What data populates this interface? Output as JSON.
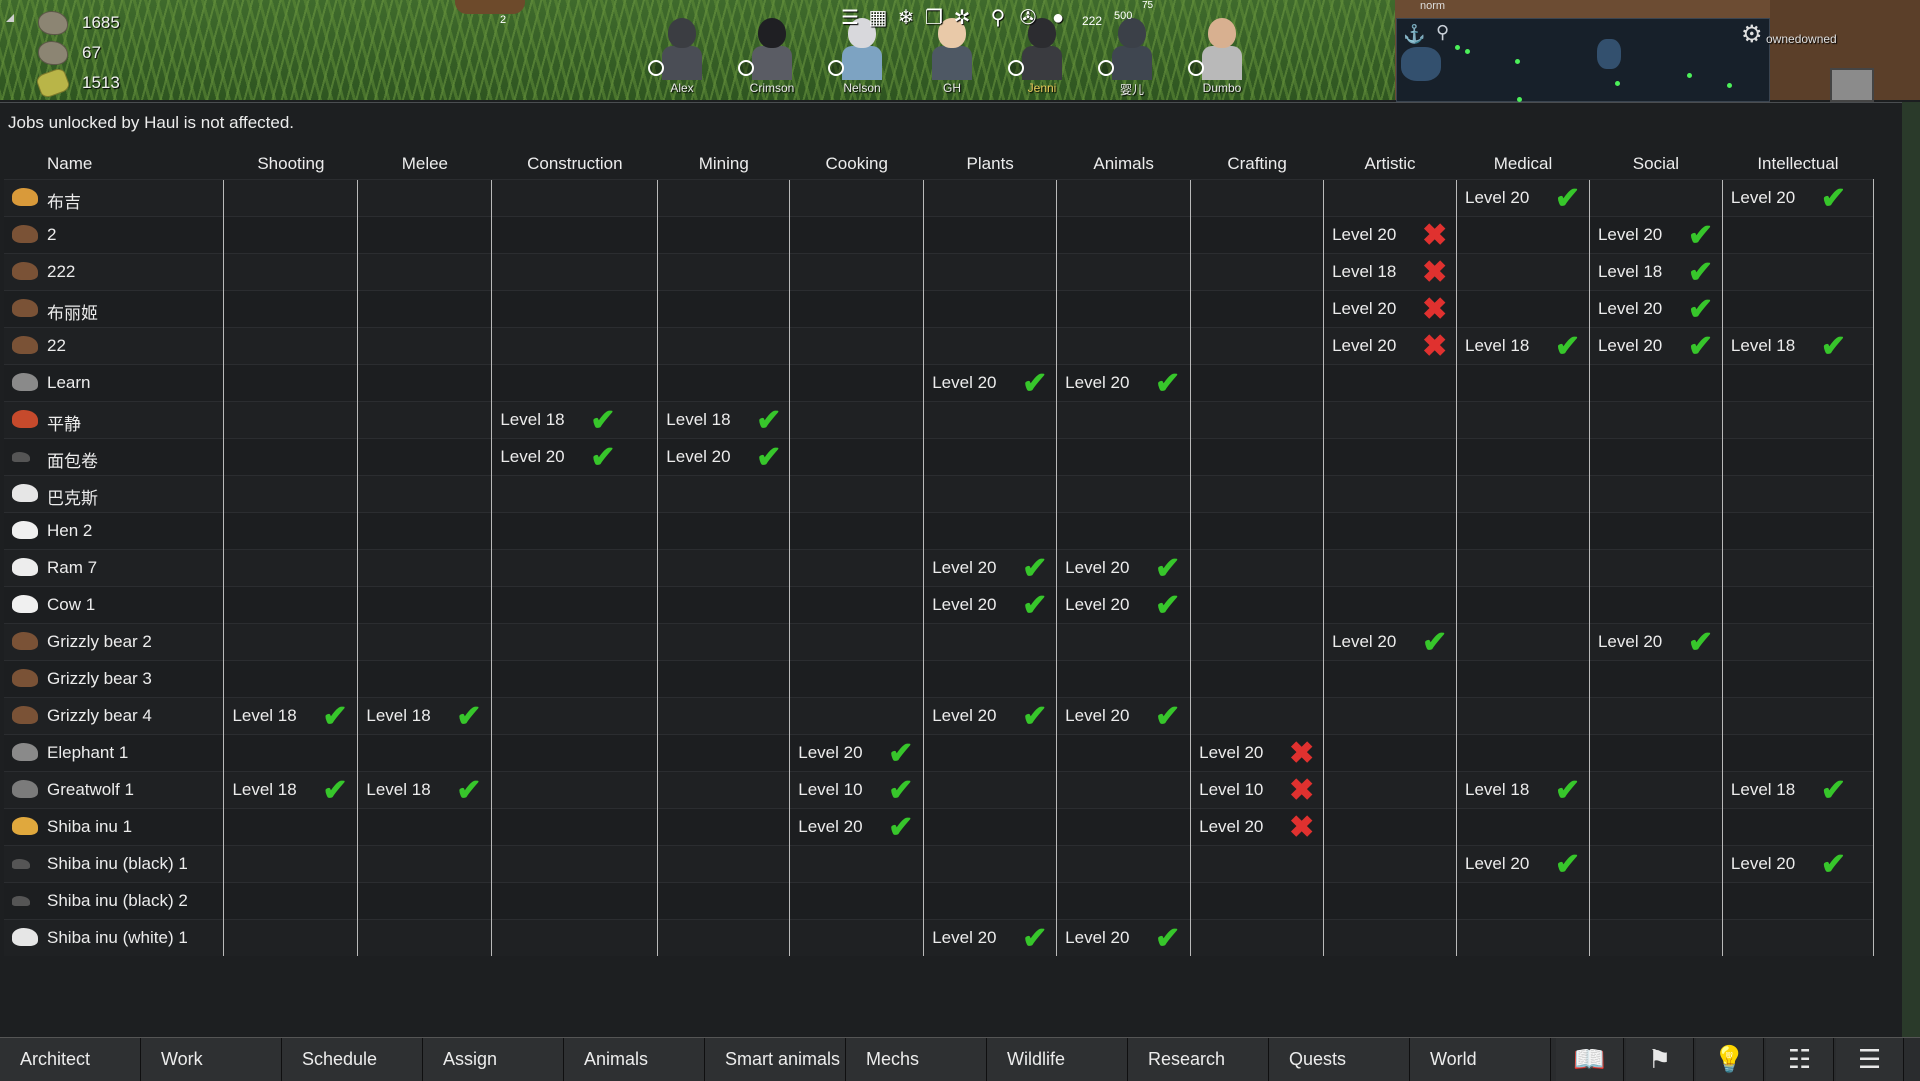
{
  "hud": {
    "resources": [
      {
        "icon": "rock-chunk-icon",
        "value": "1685"
      },
      {
        "icon": "stone-blocks-icon",
        "value": "67"
      },
      {
        "icon": "silver-icon",
        "value": "1513"
      }
    ],
    "small_number": "2",
    "colonists": [
      "Alex",
      "Crimson",
      "Nelson",
      "GH",
      "Jenni",
      "婴儿",
      "Dumbo"
    ],
    "toolbar_counts": {
      "a": "222",
      "b": "500",
      "c": "75"
    },
    "minimap_label": "norm",
    "owned_label": "ownedowned"
  },
  "notice": "Jobs unlocked by Haul is not affected.",
  "table": {
    "columns": [
      "Name",
      "Shooting",
      "Melee",
      "Construction",
      "Mining",
      "Cooking",
      "Plants",
      "Animals",
      "Crafting",
      "Artistic",
      "Medical",
      "Social",
      "Intellectual"
    ],
    "rows": [
      {
        "name": "布吉",
        "icon": "chicken-icon",
        "cells": {
          "Medical": [
            "Level 20",
            "ok"
          ],
          "Intellectual": [
            "Level 20",
            "ok"
          ]
        }
      },
      {
        "name": "2",
        "icon": "bear-icon",
        "cells": {
          "Artistic": [
            "Level 20",
            "no"
          ],
          "Social": [
            "Level 20",
            "ok"
          ]
        }
      },
      {
        "name": "222",
        "icon": "bear-icon",
        "cells": {
          "Artistic": [
            "Level 18",
            "no"
          ],
          "Social": [
            "Level 18",
            "ok"
          ]
        }
      },
      {
        "name": "布丽姬",
        "icon": "bear-icon",
        "cells": {
          "Artistic": [
            "Level 20",
            "no"
          ],
          "Social": [
            "Level 20",
            "ok"
          ]
        }
      },
      {
        "name": "22",
        "icon": "bear-icon",
        "cells": {
          "Artistic": [
            "Level 20",
            "no"
          ],
          "Medical": [
            "Level 18",
            "ok"
          ],
          "Social": [
            "Level 20",
            "ok"
          ],
          "Intellectual": [
            "Level 18",
            "ok"
          ]
        }
      },
      {
        "name": "Learn",
        "icon": "elephant-icon",
        "cells": {
          "Plants": [
            "Level 20",
            "ok"
          ],
          "Animals": [
            "Level 20",
            "ok"
          ]
        }
      },
      {
        "name": "平静",
        "icon": "bird-icon",
        "cells": {
          "Construction": [
            "Level 18",
            "ok"
          ],
          "Mining": [
            "Level 18",
            "ok"
          ]
        }
      },
      {
        "name": "面包卷",
        "icon": "dog-icon",
        "cells": {
          "Construction": [
            "Level 20",
            "ok"
          ],
          "Mining": [
            "Level 20",
            "ok"
          ]
        }
      },
      {
        "name": "巴克斯",
        "icon": "goat-icon",
        "cells": {}
      },
      {
        "name": "Hen 2",
        "icon": "hen-icon",
        "cells": {}
      },
      {
        "name": "Ram 7",
        "icon": "ram-icon",
        "cells": {
          "Plants": [
            "Level 20",
            "ok"
          ],
          "Animals": [
            "Level 20",
            "ok"
          ]
        }
      },
      {
        "name": "Cow 1",
        "icon": "cow-icon",
        "cells": {
          "Plants": [
            "Level 20",
            "ok"
          ],
          "Animals": [
            "Level 20",
            "ok"
          ]
        }
      },
      {
        "name": "Grizzly bear 2",
        "icon": "bear-icon",
        "cells": {
          "Artistic": [
            "Level 20",
            "ok"
          ],
          "Social": [
            "Level 20",
            "ok"
          ]
        }
      },
      {
        "name": "Grizzly bear 3",
        "icon": "bear-icon",
        "cells": {}
      },
      {
        "name": "Grizzly bear 4",
        "icon": "bear-icon",
        "cells": {
          "Shooting": [
            "Level 18",
            "ok"
          ],
          "Melee": [
            "Level 18",
            "ok"
          ],
          "Plants": [
            "Level 20",
            "ok"
          ],
          "Animals": [
            "Level 20",
            "ok"
          ]
        }
      },
      {
        "name": "Elephant 1",
        "icon": "elephant-icon",
        "cells": {
          "Cooking": [
            "Level 20",
            "ok"
          ],
          "Crafting": [
            "Level 20",
            "no"
          ]
        }
      },
      {
        "name": "Greatwolf 1",
        "icon": "wolf-icon",
        "cells": {
          "Shooting": [
            "Level 18",
            "ok"
          ],
          "Melee": [
            "Level 18",
            "ok"
          ],
          "Cooking": [
            "Level 10",
            "ok"
          ],
          "Crafting": [
            "Level 10",
            "no"
          ],
          "Medical": [
            "Level 18",
            "ok"
          ],
          "Intellectual": [
            "Level 18",
            "ok"
          ]
        }
      },
      {
        "name": "Shiba inu 1",
        "icon": "shiba-icon",
        "cells": {
          "Cooking": [
            "Level 20",
            "ok"
          ],
          "Crafting": [
            "Level 20",
            "no"
          ]
        }
      },
      {
        "name": "Shiba inu (black) 1",
        "icon": "dog-icon",
        "cells": {
          "Medical": [
            "Level 20",
            "ok"
          ],
          "Intellectual": [
            "Level 20",
            "ok"
          ]
        }
      },
      {
        "name": "Shiba inu (black) 2",
        "icon": "dog-icon",
        "cells": {}
      },
      {
        "name": "Shiba inu (white) 1",
        "icon": "goat-icon",
        "cells": {
          "Plants": [
            "Level 20",
            "ok"
          ],
          "Animals": [
            "Level 20",
            "ok"
          ]
        }
      }
    ]
  },
  "bottom_bar": {
    "tabs": [
      "Architect",
      "Work",
      "Schedule",
      "Assign",
      "Animals",
      "Smart animals",
      "Mechs",
      "Wildlife",
      "Research",
      "Quests",
      "World"
    ],
    "icons": [
      "book-icon",
      "factions-icon",
      "ideas-icon",
      "history-icon",
      "menu-icon"
    ]
  },
  "colors": {
    "check": "#37c62b",
    "cross": "#e0312f",
    "background": "#1d1f21"
  }
}
